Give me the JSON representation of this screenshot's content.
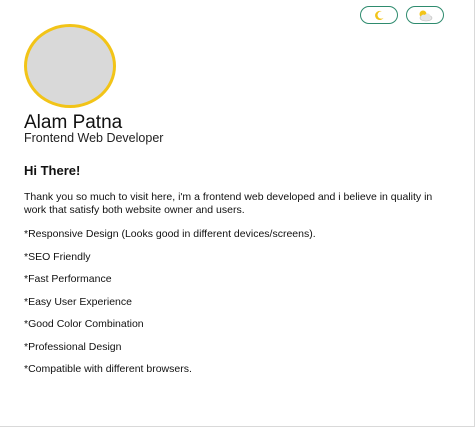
{
  "theme_toggles": [
    {
      "icon": "moon-icon",
      "label": "dark mode"
    },
    {
      "icon": "sun-cloud-icon",
      "label": "light mode"
    }
  ],
  "profile": {
    "name": "Alam Patna",
    "role": "Frontend Web Developer"
  },
  "about": {
    "greeting": "Hi There!",
    "intro": "Thank you so much to visit here, i'm a frontend web developed and i believe in quality in work that satisfy both website owner and users.",
    "features": [
      "*Responsive Design (Looks good in different devices/screens).",
      "*SEO Friendly",
      "*Fast Performance",
      "*Easy User Experience",
      "*Good Color Combination",
      "*Professional Design",
      "*Compatible with different browsers."
    ]
  },
  "colors": {
    "accent": "#2e8b6e",
    "avatar_border": "#f2c418",
    "avatar_fill": "#d9d9d9"
  }
}
